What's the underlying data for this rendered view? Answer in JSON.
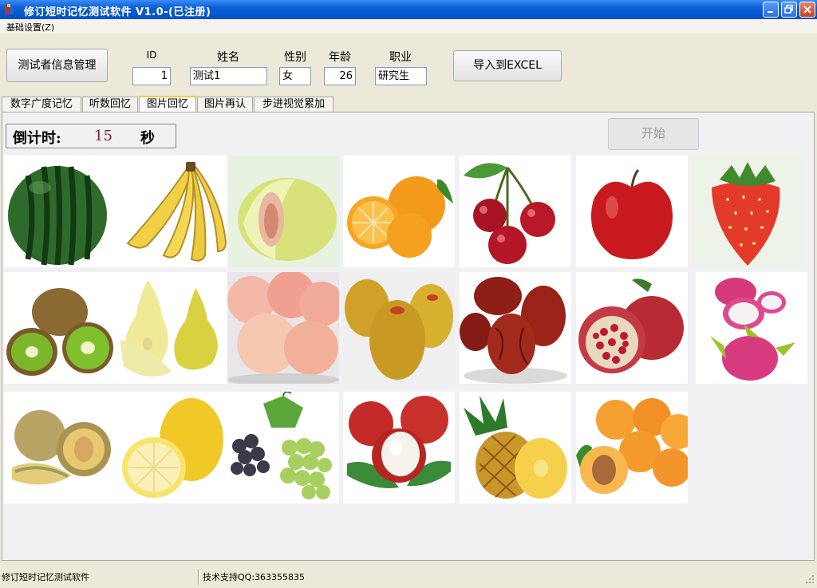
{
  "window": {
    "title": "修订短时记忆测试软件 V1.0-(已注册)"
  },
  "menu": {
    "settings": "基础设置(Z)"
  },
  "toolbar": {
    "manage_button": "测试者信息管理",
    "export_button": "导入到EXCEL",
    "id_label": "ID",
    "id_value": "1",
    "name_label": "姓名",
    "name_value": "测试1",
    "gender_label": "性别",
    "gender_value": "女",
    "age_label": "年龄",
    "age_value": "26",
    "job_label": "职业",
    "job_value": "研究生"
  },
  "tabs": [
    "数字广度记忆",
    "听数回忆",
    "图片回忆",
    "图片再认",
    "步进视觉累加"
  ],
  "active_tab": "图片回忆",
  "countdown": {
    "label": "倒计时:",
    "value": "15",
    "unit": "秒"
  },
  "start_button": "开始",
  "fruits": [
    "watermelon",
    "banana",
    "pomelo",
    "orange",
    "cherry",
    "apple",
    "strawberry",
    "kiwi",
    "pear",
    "peach",
    "mango",
    "jujube",
    "pomegranate",
    "dragonfruit",
    "cantaloupe",
    "grapefruit",
    "grapes",
    "lychee",
    "pineapple",
    "apricot"
  ],
  "status": {
    "app_name": "修订短时记忆测试软件",
    "support": "技术支持QQ:363355835"
  },
  "colors": {
    "title_bar": "#0a5fd6",
    "countdown_value": "#8b1a1a",
    "tab_highlight": "#ffc83c"
  }
}
